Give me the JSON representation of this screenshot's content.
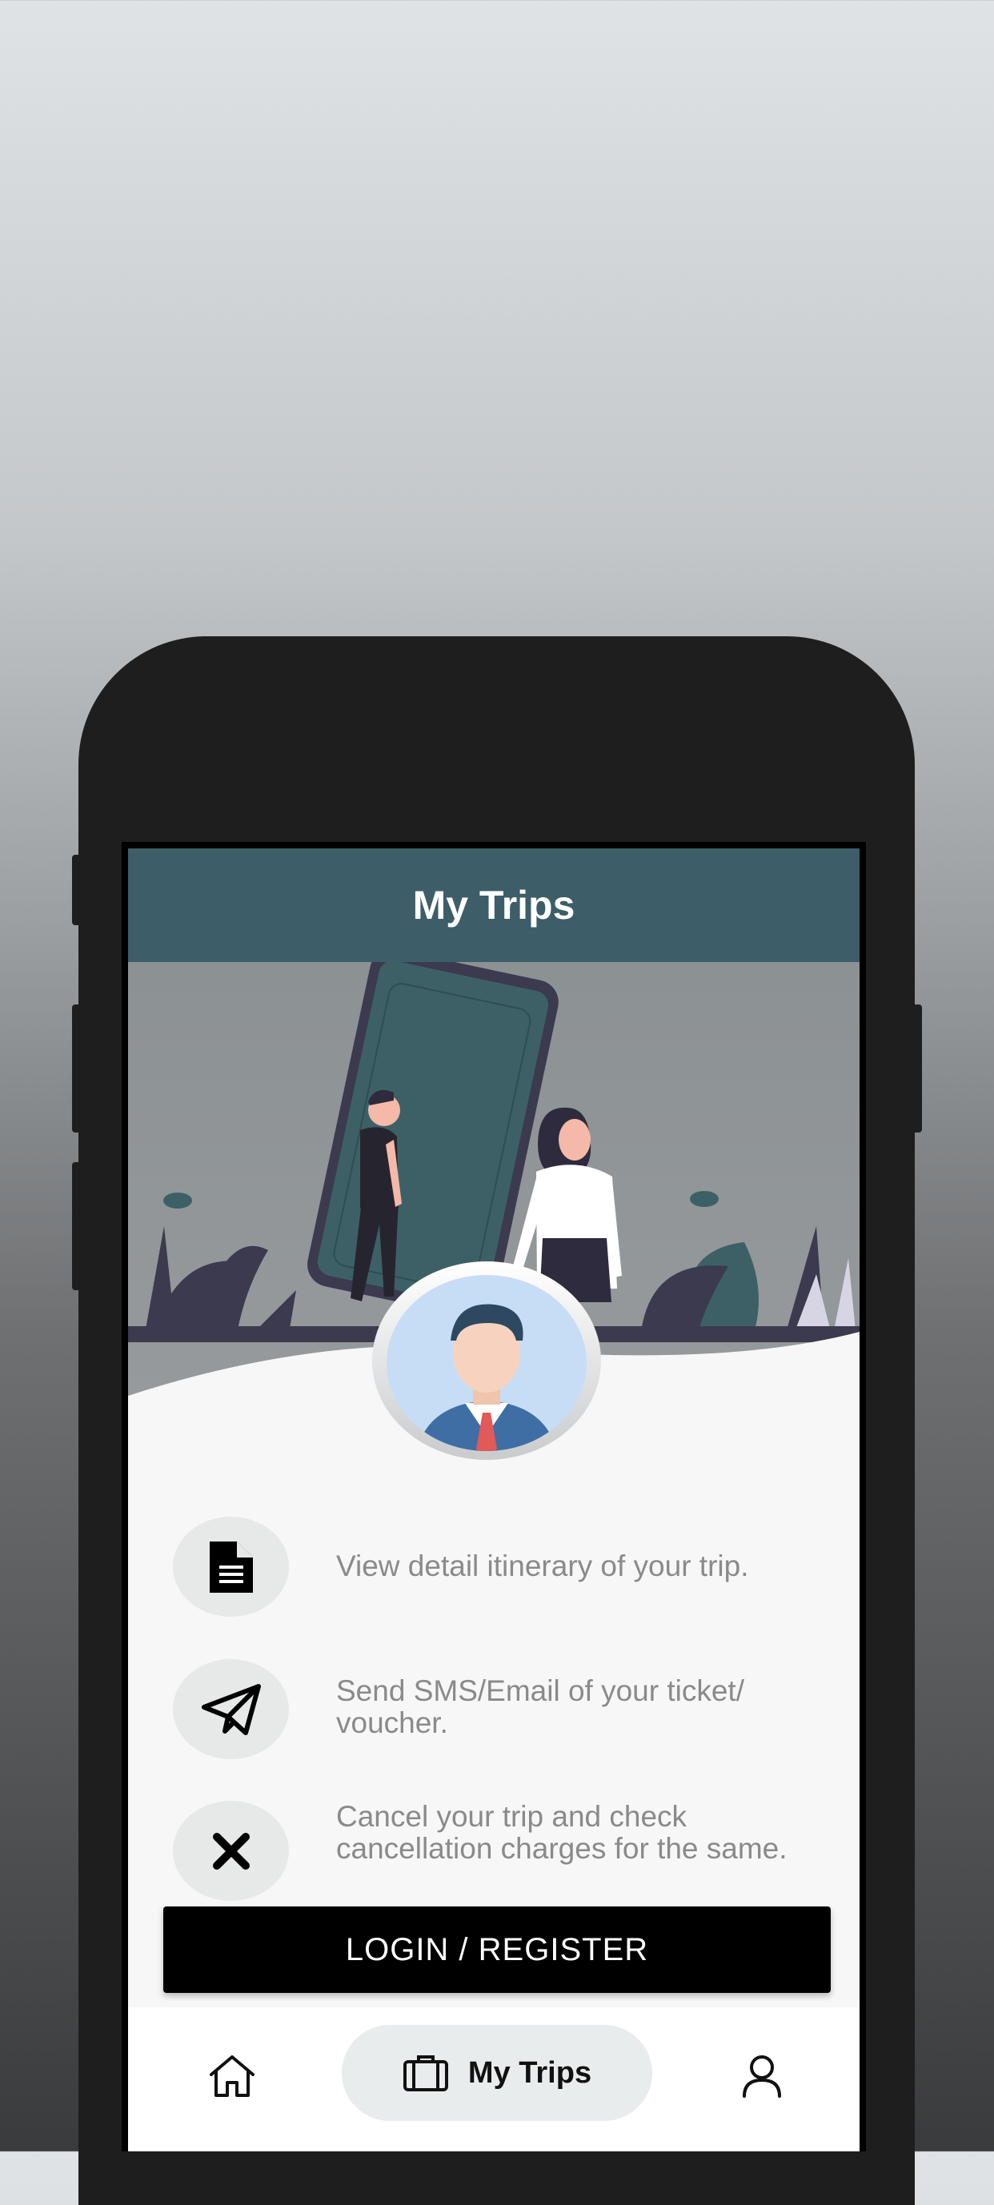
{
  "header": {
    "title": "My Trips"
  },
  "features": [
    {
      "icon": "document-icon",
      "text": "View detail itinerary of your trip."
    },
    {
      "icon": "send-icon",
      "text": "Send SMS/Email of your ticket/ voucher."
    },
    {
      "icon": "close-icon",
      "text": "Cancel your trip and check cancellation charges for the same."
    }
  ],
  "login_button": {
    "label": "LOGIN / REGISTER"
  },
  "bottom_nav": {
    "home": {
      "icon": "home-icon"
    },
    "trips": {
      "icon": "briefcase-icon",
      "label": "My Trips",
      "active": true
    },
    "profile": {
      "icon": "user-icon"
    }
  },
  "colors": {
    "header": "#3d5e68",
    "accent_dark": "#3b3a4e",
    "button": "#000000"
  }
}
